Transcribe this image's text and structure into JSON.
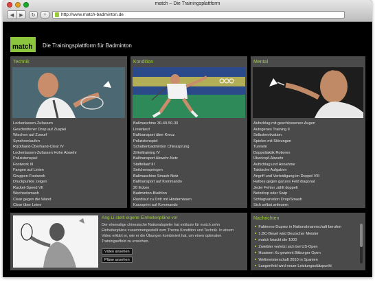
{
  "window": {
    "title": "match – Die Trainingsplattform"
  },
  "toolbar": {
    "url": "http://www.match-badminton.de"
  },
  "header": {
    "logo": "match",
    "tagline": "Die Trainingsplattform für Badminton"
  },
  "sections": [
    {
      "title": "Technik",
      "items": [
        "Lockerlassen-Zufassen",
        "Geschnittener Drop auf Zuspiel",
        "Wischen auf Zuwurf",
        "Synchronlaufen",
        "Rückhand-Überhand-Clear IV",
        "Lockerlassen-Zufassen Hohe Abwehr",
        "Polizistenspiel",
        "Footwork III",
        "Fangen auf Linien",
        "Gruppen-Footwork",
        "Druckpunkte zeigen",
        "Racket-Speed VII",
        "Wechselsmash",
        "Clear gegen die Wand",
        "Clear über Leine"
      ]
    },
    {
      "title": "Kondition",
      "items": [
        "Ballmaschine 30-40-50-30",
        "Linienlauf",
        "Balltransport über Kreuz",
        "Polizistenspiel",
        "Schattenbadminton Chinasprung",
        "Zirkeltraining IV",
        "Balltransport Abwehr-Netz",
        "Staffellauf III",
        "Seilchenspringen",
        "Ballmaschine Smash-Netz",
        "Balltransport auf Kommando",
        "20 Ecken",
        "Badminton-Biathlon",
        "Rundlauf zu Dritt mit Hindernissen",
        "Kurzsprint auf Kommando"
      ]
    },
    {
      "title": "Mental",
      "items": [
        "Aufschlag mit geschlossenen Augen",
        "Autogenes Training II",
        "Selbstmotivation",
        "Spielen mit Störungen",
        "Tunneln",
        "Doppeltaktik Rotieren",
        "Überkopf-Abwehr",
        "Aufschlag und Annahme",
        "Taktische Aufgaben",
        "Angriff und Verteidigung im Doppel VIII",
        "Halbes gegen ganzes Feld diagonal",
        "Jeder Fehler zählt doppelt",
        "Netzdrop oder Swip",
        "Schlagvariation Drop/Smash",
        "Sich selbst anfeuern"
      ]
    }
  ],
  "feature": {
    "title": "Ang Li stellt eigene Einheitenpläne vor",
    "text": "Der ehemalige chinesische Nationalspieler hat exklusiv für match zehn Einheitenpläne zusammengestellt zum Thema Kondition und Technik. In einem Video erklärt er, wie er die Übungen kombiniert hat, um einen optimalen Trainingseffekt zu erreichen.",
    "video_button": "Video ansehen",
    "plans_button": "Pläne ansehen"
  },
  "news": {
    "title": "Nachrichten",
    "items": [
      "Fabienne Duprez in Nationalmannschaft berufen",
      "1.BC-Beuel wird Deutscher Meister",
      "match knackt die 1000",
      "Zwiebler verletzt sich bei US-Open",
      "Huaiwen Xu gewinnt Bitburger Open",
      "Weltmeisterschaft 2010 in Spanien",
      "Langenfeld wird neuer Leistungsstützpunkt"
    ]
  },
  "colors": {
    "accent": "#8cc63f",
    "panel": "#4a4a4a",
    "background": "#000000"
  }
}
